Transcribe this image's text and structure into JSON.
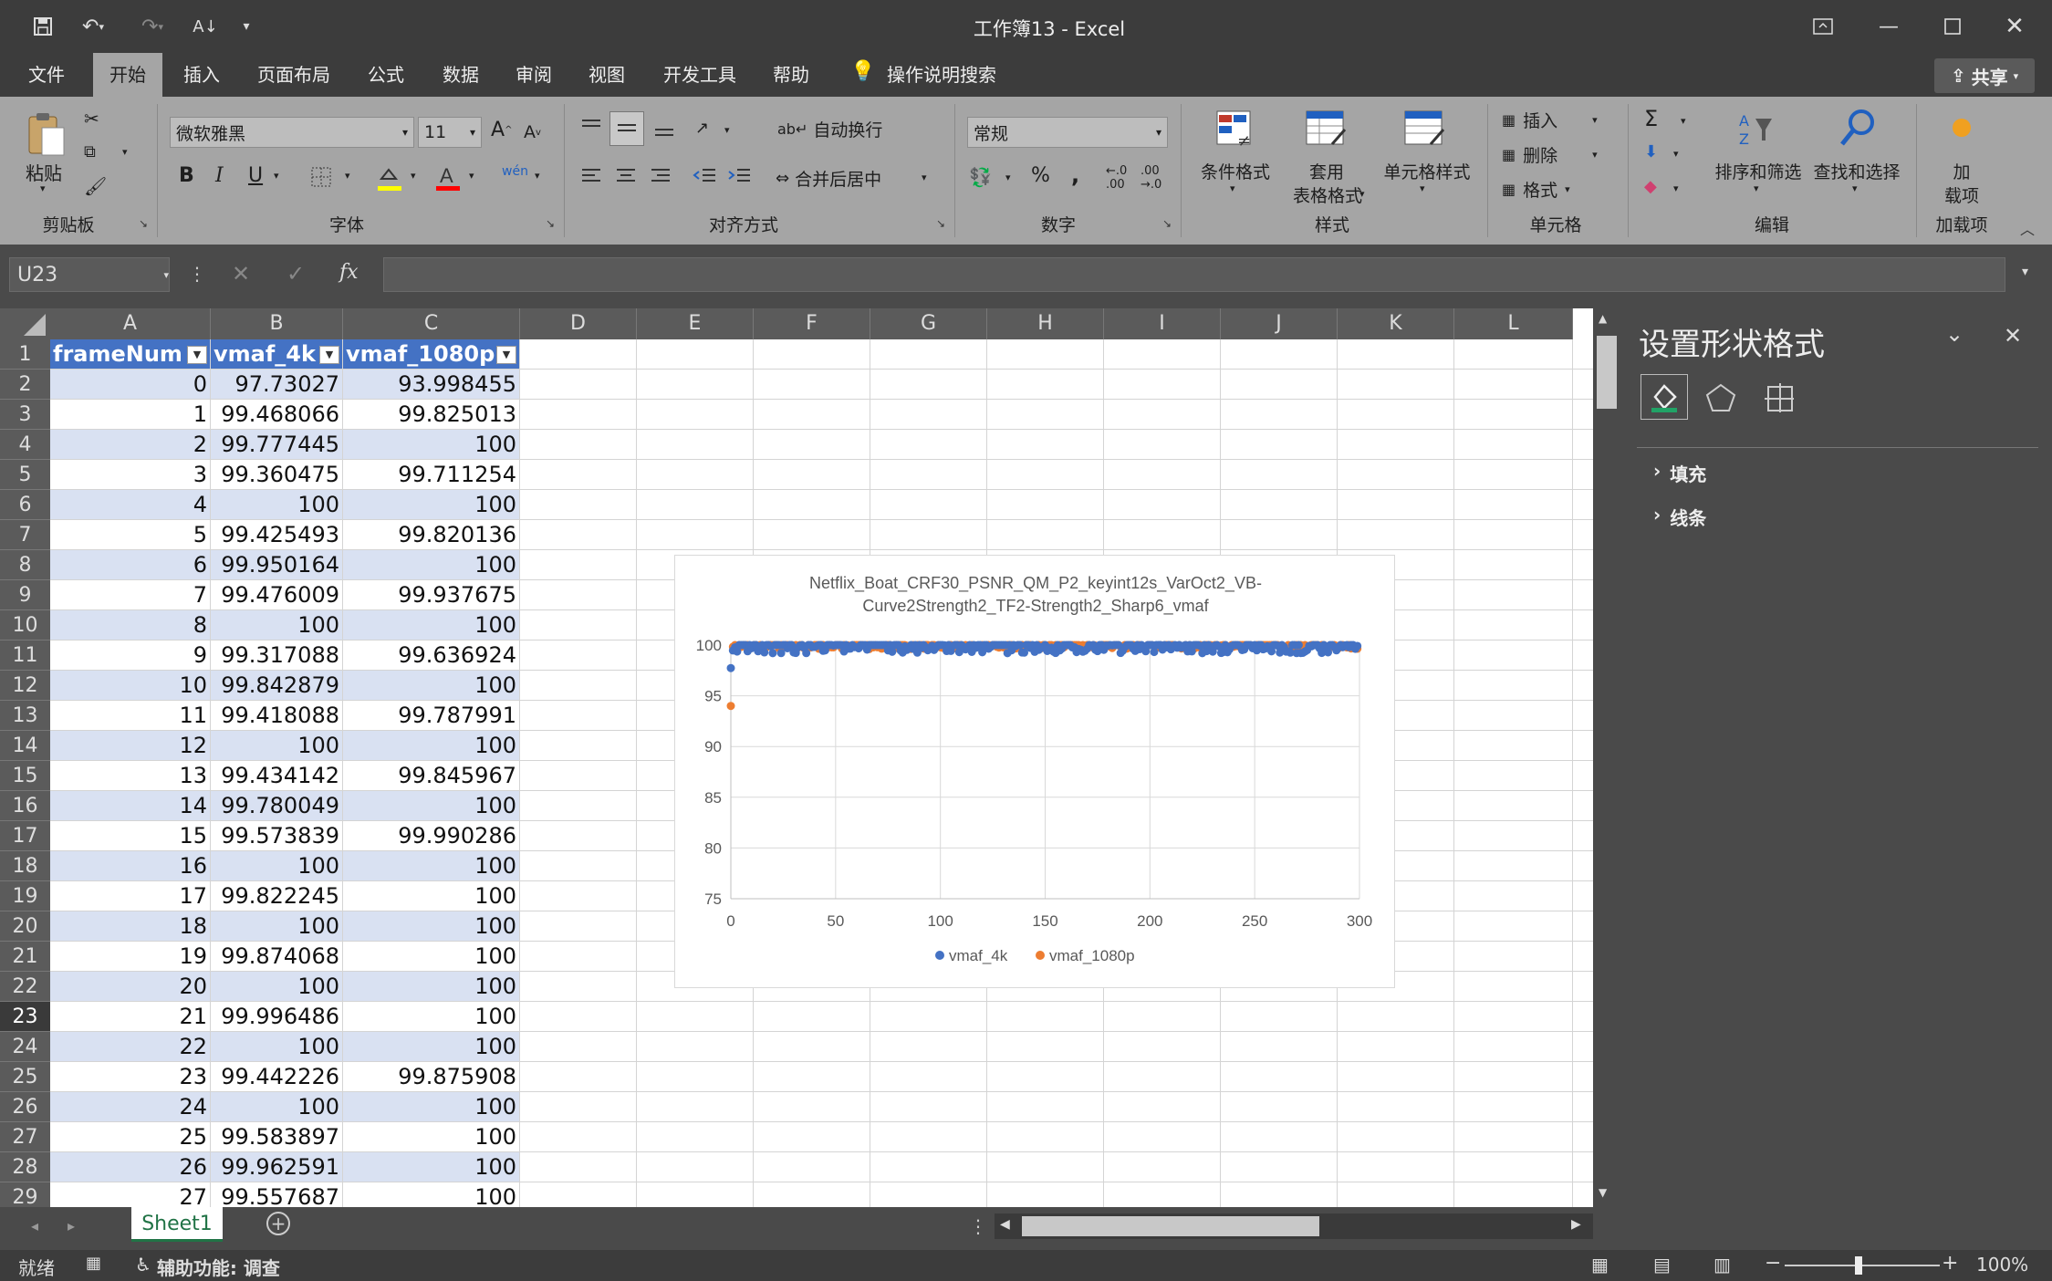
{
  "window": {
    "title": "工作簿13  -  Excel"
  },
  "quick_access": {
    "save_icon": "save-icon",
    "undo_icon": "undo-icon",
    "redo_icon": "redo-icon",
    "sort_icon": "sort-icon"
  },
  "tabs": [
    "文件",
    "开始",
    "插入",
    "页面布局",
    "公式",
    "数据",
    "审阅",
    "视图",
    "开发工具",
    "帮助"
  ],
  "active_tab": "开始",
  "tell_me": "操作说明搜索",
  "share_label": "共享",
  "ribbon": {
    "clipboard": {
      "paste": "粘贴",
      "group": "剪贴板"
    },
    "font": {
      "family": "微软雅黑",
      "size": "11",
      "group": "字体",
      "bold": "B",
      "italic": "I",
      "underline": "U",
      "grow": "A",
      "shrink": "A",
      "wen": "wén"
    },
    "alignment": {
      "wrap": "自动换行",
      "merge": "合并后居中",
      "group": "对齐方式"
    },
    "number": {
      "format": "常规",
      "percent": "%",
      "comma": ",",
      "group": "数字"
    },
    "styles": {
      "conditional": "条件格式",
      "table1": "套用",
      "table2": "表格格式",
      "cell_styles": "单元格样式",
      "group": "样式"
    },
    "cells": {
      "insert": "插入",
      "delete": "删除",
      "format": "格式",
      "group": "单元格"
    },
    "editing": {
      "sigma": "Σ",
      "sort": "排序和筛选",
      "find": "查找和选择",
      "group": "编辑"
    },
    "addins": {
      "label1": "加",
      "label2": "载项",
      "group": "加载项"
    }
  },
  "formula_bar": {
    "name_box": "U23",
    "fx": "fx",
    "content": ""
  },
  "columns": [
    "A",
    "B",
    "C",
    "D",
    "E",
    "F",
    "G",
    "H",
    "I",
    "J",
    "K",
    "L"
  ],
  "table": {
    "headers": [
      "frameNum",
      "vmaf_4k",
      "vmaf_1080p"
    ],
    "rows": [
      [
        "0",
        "97.73027",
        "93.998455"
      ],
      [
        "1",
        "99.468066",
        "99.825013"
      ],
      [
        "2",
        "99.777445",
        "100"
      ],
      [
        "3",
        "99.360475",
        "99.711254"
      ],
      [
        "4",
        "100",
        "100"
      ],
      [
        "5",
        "99.425493",
        "99.820136"
      ],
      [
        "6",
        "99.950164",
        "100"
      ],
      [
        "7",
        "99.476009",
        "99.937675"
      ],
      [
        "8",
        "100",
        "100"
      ],
      [
        "9",
        "99.317088",
        "99.636924"
      ],
      [
        "10",
        "99.842879",
        "100"
      ],
      [
        "11",
        "99.418088",
        "99.787991"
      ],
      [
        "12",
        "100",
        "100"
      ],
      [
        "13",
        "99.434142",
        "99.845967"
      ],
      [
        "14",
        "99.780049",
        "100"
      ],
      [
        "15",
        "99.573839",
        "99.990286"
      ],
      [
        "16",
        "100",
        "100"
      ],
      [
        "17",
        "99.822245",
        "100"
      ],
      [
        "18",
        "100",
        "100"
      ],
      [
        "19",
        "99.874068",
        "100"
      ],
      [
        "20",
        "100",
        "100"
      ],
      [
        "21",
        "99.996486",
        "100"
      ],
      [
        "22",
        "100",
        "100"
      ],
      [
        "23",
        "99.442226",
        "99.875908"
      ],
      [
        "24",
        "100",
        "100"
      ],
      [
        "25",
        "99.583897",
        "100"
      ],
      [
        "26",
        "99.962591",
        "100"
      ],
      [
        "27",
        "99.557687",
        "100"
      ]
    ]
  },
  "row_numbers": [
    "1",
    "2",
    "3",
    "4",
    "5",
    "6",
    "7",
    "8",
    "9",
    "10",
    "11",
    "12",
    "13",
    "14",
    "15",
    "16",
    "17",
    "18",
    "19",
    "20",
    "21",
    "22",
    "23",
    "24",
    "25",
    "26",
    "27",
    "28",
    "29"
  ],
  "selected_row": "23",
  "chart_data": {
    "type": "scatter",
    "title": "Netflix_Boat_CRF30_PSNR_QM_P2_keyint12s_VarOct2_VB-Curve2Strength2_TF2-Strength2_Sharp6_vmaf",
    "title_line1": "Netflix_Boat_CRF30_PSNR_QM_P2_keyint12s_VarOct2_VB-",
    "title_line2": "Curve2Strength2_TF2-Strength2_Sharp6_vmaf",
    "xlim": [
      0,
      300
    ],
    "ylim": [
      75,
      100
    ],
    "x_ticks": [
      "0",
      "50",
      "100",
      "150",
      "200",
      "250",
      "300"
    ],
    "y_ticks": [
      "75",
      "80",
      "85",
      "90",
      "95",
      "100"
    ],
    "grid": true,
    "legend_position": "bottom",
    "series": [
      {
        "name": "vmaf_4k",
        "color": "#4472c4",
        "first_points": [
          [
            0,
            97.73
          ],
          [
            1,
            99.47
          ],
          [
            2,
            99.78
          ],
          [
            3,
            99.36
          ],
          [
            4,
            100
          ]
        ],
        "range_after_first": [
          99.2,
          100
        ]
      },
      {
        "name": "vmaf_1080p",
        "color": "#ed7d31",
        "first_points": [
          [
            0,
            94.0
          ],
          [
            1,
            99.83
          ],
          [
            2,
            100
          ],
          [
            3,
            99.71
          ],
          [
            4,
            100
          ]
        ],
        "range_after_first": [
          99.6,
          100
        ]
      }
    ],
    "n_points": 300
  },
  "format_pane": {
    "title": "设置形状格式",
    "sections": [
      "填充",
      "线条"
    ]
  },
  "sheet_tab": "Sheet1",
  "status": {
    "ready": "就绪",
    "accessibility": "辅助功能: 调查",
    "zoom": "100%"
  },
  "colors": {
    "accent": "#4472c4",
    "band": "#d9e1f2",
    "ribbon": "#a5a5a5",
    "dark": "#3c3c3c"
  }
}
